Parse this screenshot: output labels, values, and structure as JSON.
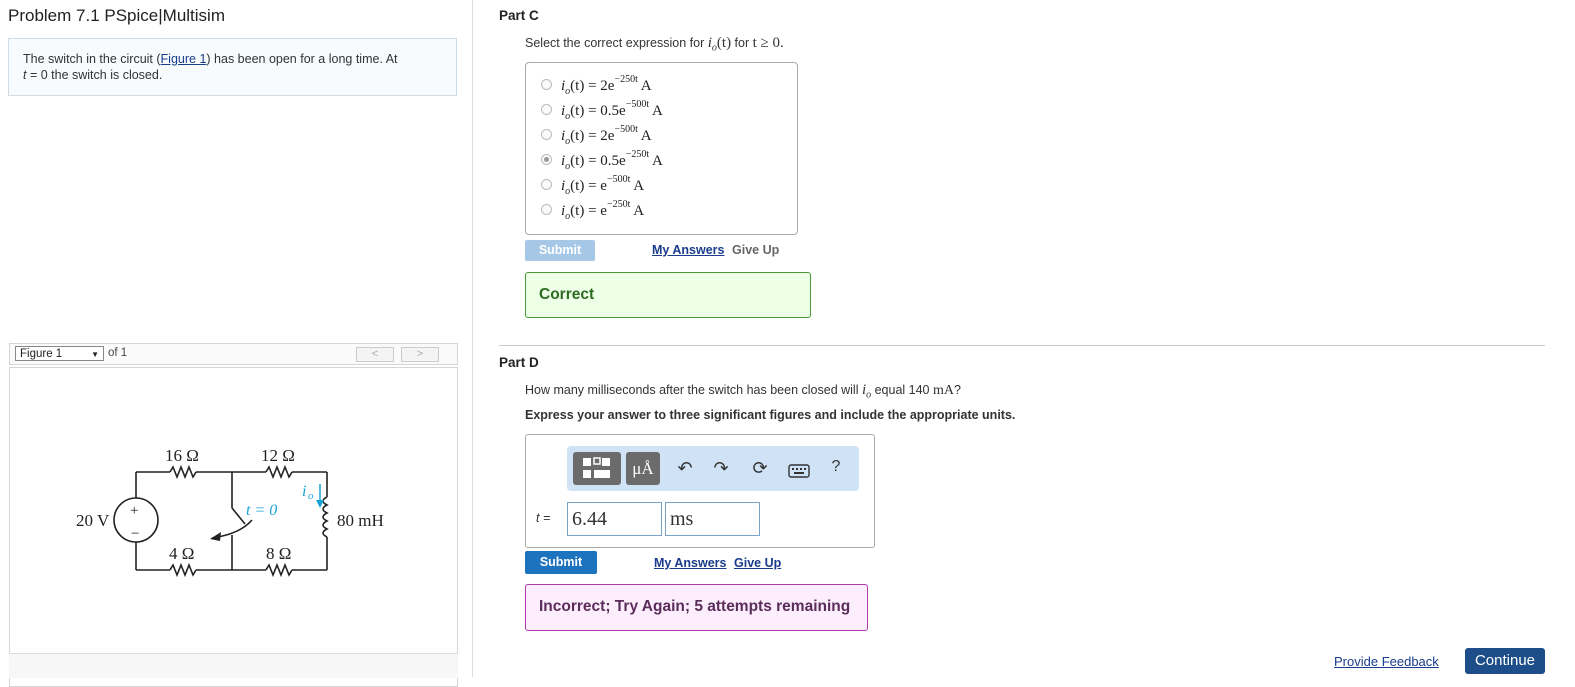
{
  "left": {
    "problem_title": "Problem 7.1 PSpice|Multisim",
    "statement": {
      "part1": "The switch in the circuit (",
      "figure_link": "Figure 1",
      "part2": ") has been open for a long time. At",
      "t_var": "t",
      "part3": " = 0 the switch is closed."
    },
    "figure_nav": {
      "selected": "Figure 1",
      "of_text": "of 1",
      "prev": "<",
      "next": ">"
    },
    "circuit": {
      "source": "20 V",
      "plus": "+",
      "minus": "−",
      "r_top_left": "16 Ω",
      "r_top_right": "12 Ω",
      "r_bot_left": "4 Ω",
      "r_bot_right": "8 Ω",
      "inductor": "80 mH",
      "switch_label": "t = 0",
      "current_label": "i",
      "current_sub": "o"
    }
  },
  "partC": {
    "title": "Part C",
    "question_pre": "Select the correct expression for ",
    "question_expr": "i",
    "question_sub": "o",
    "question_mid": "(t)",
    "question_post": " for ",
    "question_cond": "t ≥ 0.",
    "options": [
      {
        "lhs": "i",
        "sub": "o",
        "rest": "(t) = 2e",
        "exp": "−250t",
        "unit": " A",
        "selected": false
      },
      {
        "lhs": "i",
        "sub": "o",
        "rest": "(t) = 0.5e",
        "exp": "−500t",
        "unit": " A",
        "selected": false
      },
      {
        "lhs": "i",
        "sub": "o",
        "rest": "(t) = 2e",
        "exp": "−500t",
        "unit": " A",
        "selected": false
      },
      {
        "lhs": "i",
        "sub": "o",
        "rest": "(t) = 0.5e",
        "exp": "−250t",
        "unit": " A",
        "selected": true
      },
      {
        "lhs": "i",
        "sub": "o",
        "rest": "(t) = e",
        "exp": "−500t",
        "unit": " A",
        "selected": false
      },
      {
        "lhs": "i",
        "sub": "o",
        "rest": "(t) = e",
        "exp": "−250t",
        "unit": " A",
        "selected": false
      }
    ],
    "submit_label": "Submit",
    "my_answers": "My Answers",
    "give_up": "Give Up",
    "feedback": "Correct"
  },
  "partD": {
    "title": "Part D",
    "question_pre": "How many milliseconds after the switch has been closed will ",
    "question_var": "i",
    "question_sub": "o",
    "question_mid": " equal 140 ",
    "question_unit": "mA",
    "question_post": "?",
    "instruction": "Express your answer to three significant figures and include the appropriate units.",
    "toolbar": {
      "units_label": "μÅ",
      "help": "?"
    },
    "var_label": "t =",
    "value": "6.44",
    "unit": "ms",
    "submit_label": "Submit",
    "my_answers": "My Answers",
    "give_up": "Give Up",
    "feedback": "Incorrect; Try Again; 5 attempts remaining"
  },
  "footer": {
    "feedback_link": "Provide Feedback",
    "continue": "Continue"
  }
}
